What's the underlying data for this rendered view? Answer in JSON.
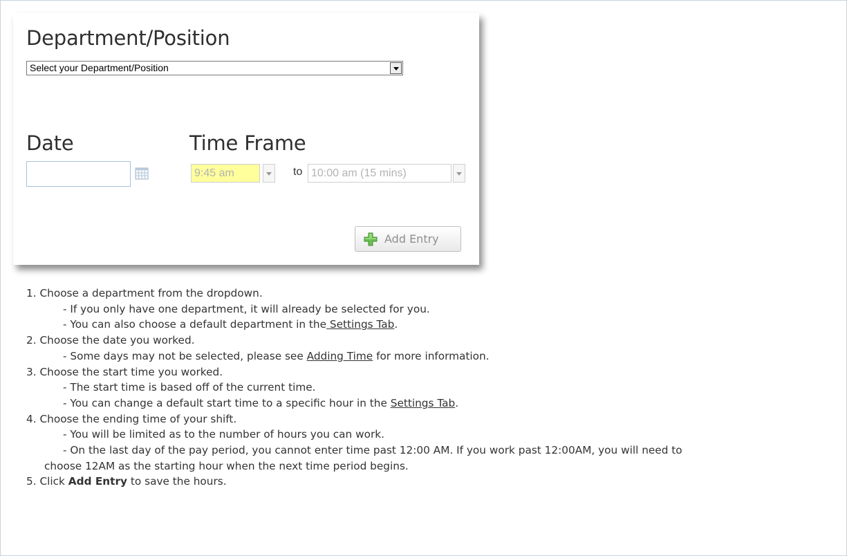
{
  "form": {
    "department_heading": "Department/Position",
    "department_select_value": "Select your Department/Position",
    "date_heading": "Date",
    "date_value": "",
    "timeframe_heading": "Time Frame",
    "start_time_value": "9:45 am",
    "to_label": "to",
    "end_time_value": "10:00 am (15 mins)",
    "add_entry_label": "Add Entry"
  },
  "instructions": {
    "step1": "1. Choose a department from the dropdown.",
    "step1_sub1": "- If you only have one department, it will already be selected for you.",
    "step1_sub2_prefix": "- You can also choose a default department in the",
    "step1_sub2_link": " Settings Tab",
    "step1_sub2_suffix": ".",
    "step2": "2. Choose the date you worked.",
    "step2_sub1_prefix": "- Some days may not be selected, please see ",
    "step2_sub1_link": "Adding Time",
    "step2_sub1_suffix": " for more information.",
    "step3": "3. Choose the start time you worked.",
    "step3_sub1": "- The start time is based off of the current time.",
    "step3_sub2_prefix": "- You can change a default start time to a specific hour in the ",
    "step3_sub2_link": "Settings Tab",
    "step3_sub2_suffix": ".",
    "step4": "4. Choose the ending time of your shift.",
    "step4_sub1": "- You will be limited as to the number of hours you can work.",
    "step4_sub2": "- On the last day of the pay period, you cannot enter time past 12:00 AM. If you work past 12:00AM, you will need to",
    "step4_sub2_cont": "choose 12AM as the starting hour when the next time period begins.",
    "step5_prefix": "5. Click ",
    "step5_bold": "Add Entry",
    "step5_suffix": " to save the hours."
  },
  "colors": {
    "start_time_highlight": "#ffff9c",
    "border": "#c9d3dc",
    "add_icon": "#5fb04a"
  }
}
